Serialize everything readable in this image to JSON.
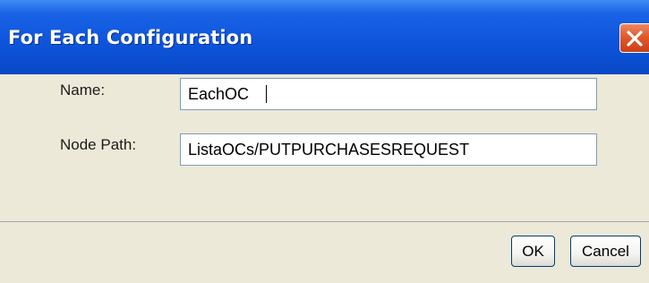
{
  "window": {
    "title": "For Each Configuration",
    "close_icon": "close-icon"
  },
  "form": {
    "name_label": "Name:",
    "name_value": "EachOC",
    "node_path_label": "Node Path:",
    "node_path_value": "ListaOCs/PUTPURCHASESREQUEST"
  },
  "buttons": {
    "ok_label": "OK",
    "cancel_label": "Cancel"
  },
  "colors": {
    "titlebar": "#0b4fd1",
    "dialog_bg": "#ece9d8",
    "close_button": "#e25a2b",
    "field_border": "#7f9db9"
  }
}
